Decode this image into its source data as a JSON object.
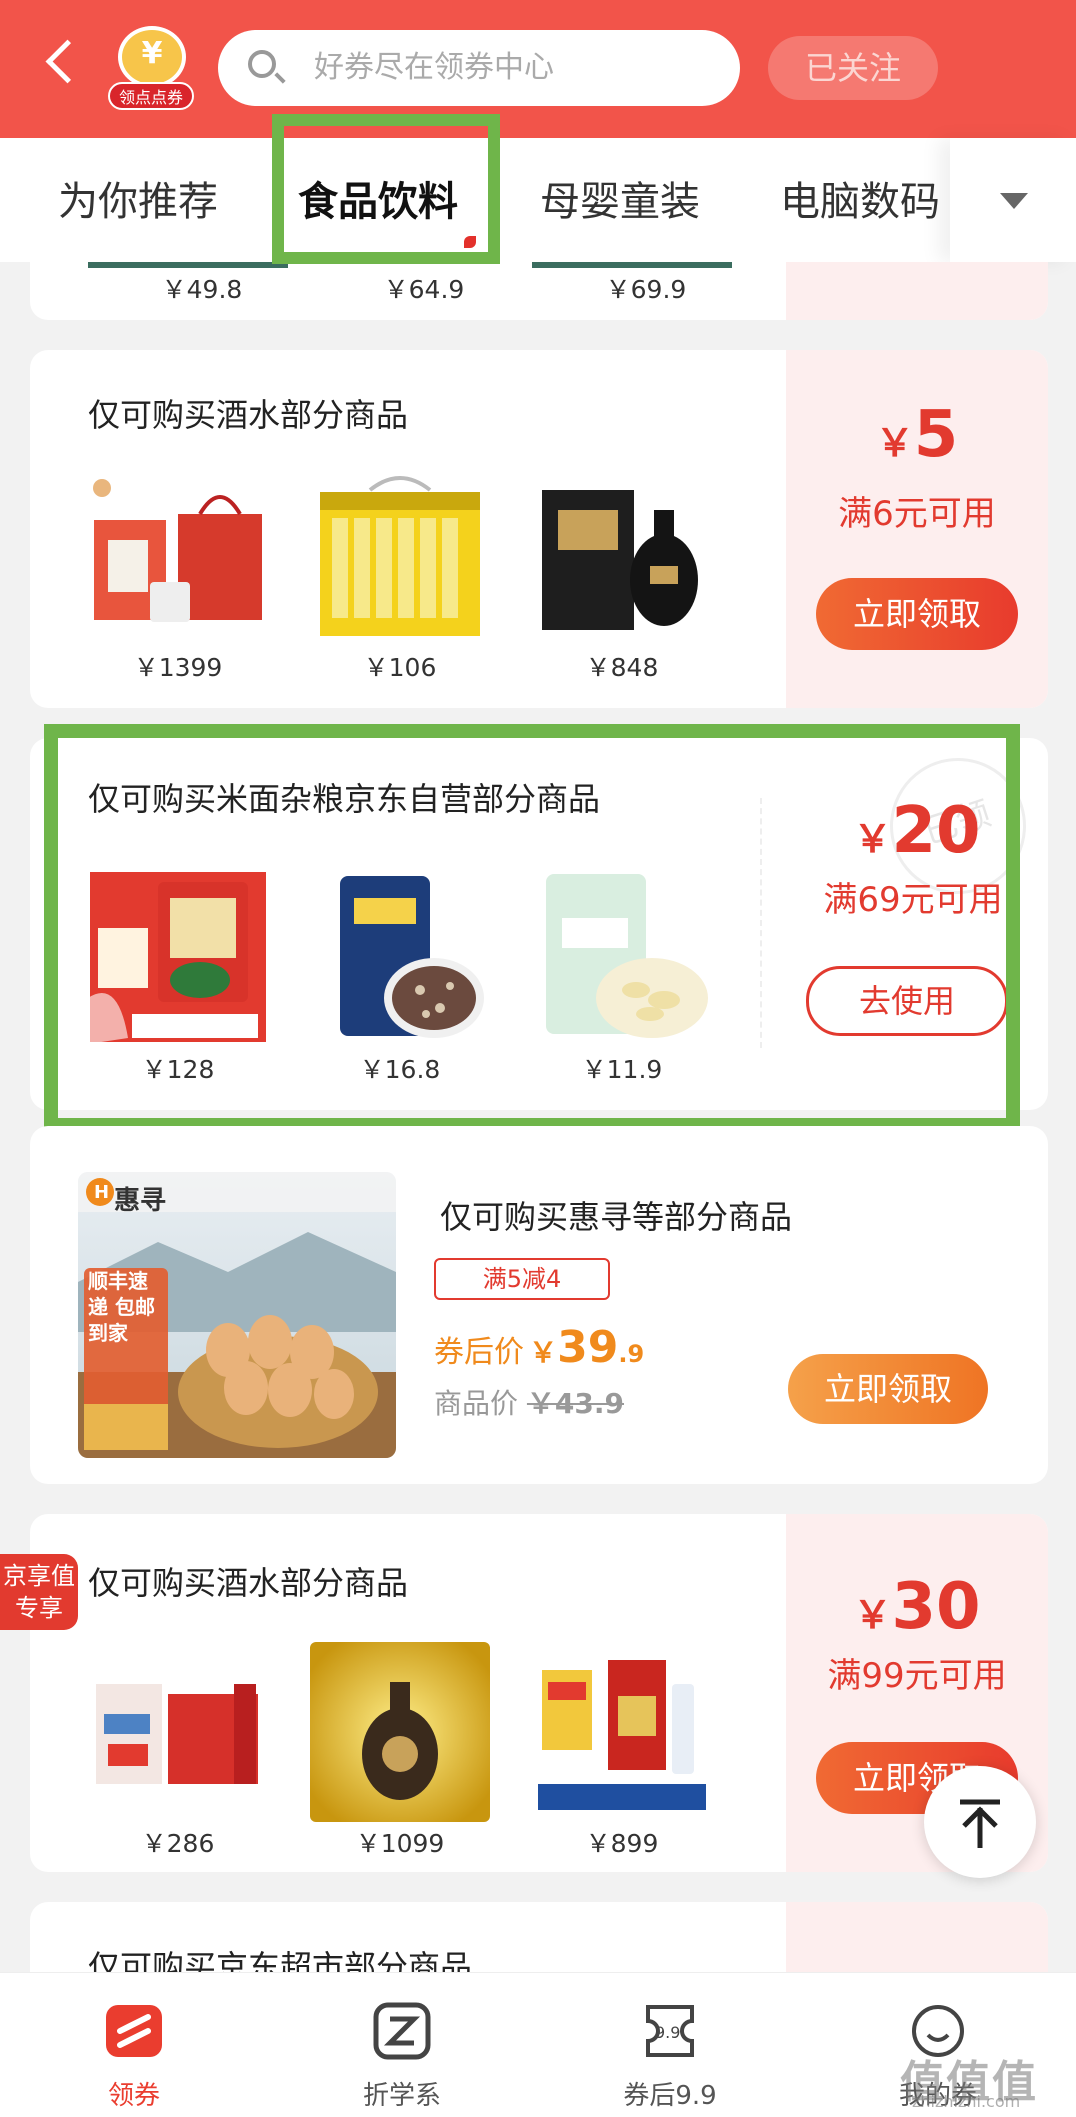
{
  "header": {
    "logo_label": "领点点券",
    "search_placeholder": "好券尽在领券中心",
    "follow_label": "已关注"
  },
  "tabs": [
    {
      "label": "为你推荐",
      "active": false
    },
    {
      "label": "食品饮料",
      "active": true
    },
    {
      "label": "母婴童装",
      "active": false
    },
    {
      "label": "电脑数码",
      "active": false
    }
  ],
  "prev_card": {
    "prices": [
      "￥49.8",
      "￥64.9",
      "￥69.9"
    ]
  },
  "coupon1": {
    "title": "仅可购买酒水部分商品",
    "prices": [
      "￥1399",
      "￥106",
      "￥848"
    ],
    "yen": "￥",
    "amount": "5",
    "condition": "满6元可用",
    "button": "立即领取"
  },
  "coupon2": {
    "title": "仅可购买米面杂粮京东自营部分商品",
    "prices": [
      "￥128",
      "￥16.8",
      "￥11.9"
    ],
    "yen": "￥",
    "amount": "20",
    "condition": "满69元可用",
    "button": "去使用",
    "stamp": "已领"
  },
  "product_card": {
    "brand": "惠寻",
    "image_tag": "顺丰速递 包邮到家",
    "title": "仅可购买惠寻等部分商品",
    "tag": "满5减4",
    "after_label": "券后价",
    "after_price_yen": "￥",
    "after_price_int": "39",
    "after_price_dec": ".9",
    "orig_label": "商品价",
    "orig_price": "￥43.9",
    "button": "立即领取"
  },
  "coupon3": {
    "badge": "京享值 专享",
    "title": "仅可购买酒水部分商品",
    "prices": [
      "￥286",
      "￥1099",
      "￥899"
    ],
    "yen": "￥",
    "amount": "30",
    "condition": "满99元可用",
    "button": "立即领取"
  },
  "coupon4": {
    "title": "仅可购买京东超市部分商品"
  },
  "bottom_nav": [
    {
      "label": "领券",
      "active": true
    },
    {
      "label": "折学系",
      "active": false
    },
    {
      "label": "券后9.9",
      "active": false
    },
    {
      "label": "我的券",
      "active": false
    }
  ],
  "watermark": {
    "text": "值值值",
    "sub": "zhizhizhi.com"
  },
  "colors": {
    "header": "#f2544a",
    "accent": "#e23a2f",
    "highlight": "#6fb54a"
  }
}
